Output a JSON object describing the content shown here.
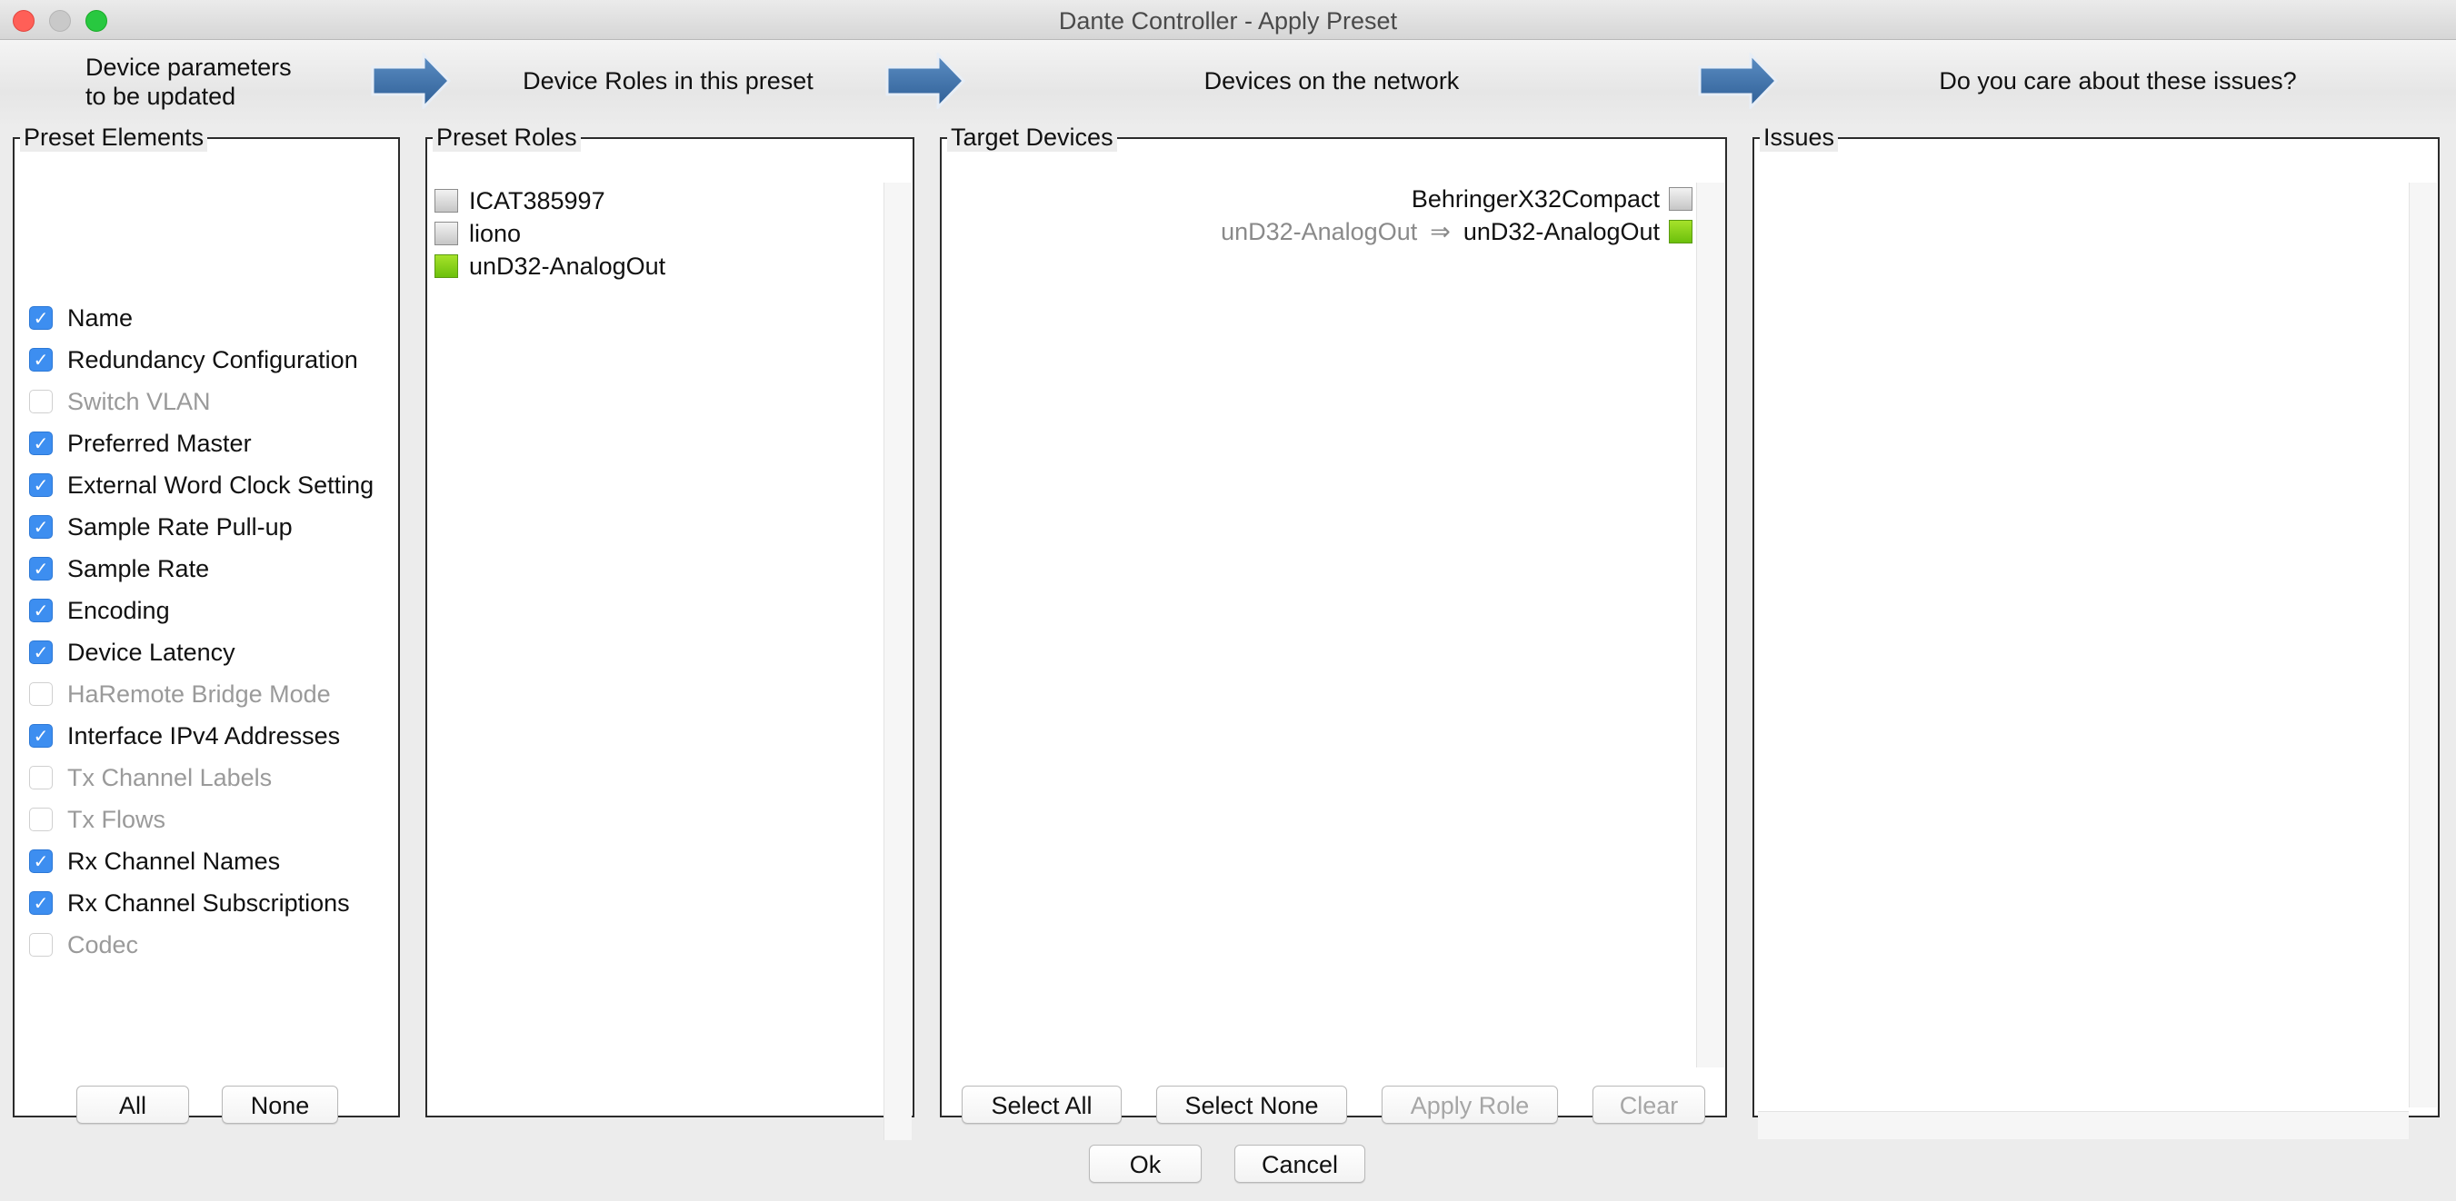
{
  "window": {
    "title": "Dante Controller - Apply Preset"
  },
  "steps": [
    {
      "line1": "Device parameters",
      "line2": "to be updated"
    },
    {
      "label": "Device Roles in this preset"
    },
    {
      "label": "Devices on the network"
    },
    {
      "label": "Do you care about these issues?"
    }
  ],
  "icons": {
    "step_arrow": "right-arrow-icon"
  },
  "colors": {
    "checkbox_on": "#3d8ef0",
    "role_assigned": "#8bd31a",
    "role_unassigned": "#d6d6d6"
  },
  "preset_elements": {
    "legend": "Preset Elements",
    "items": [
      {
        "label": "Name",
        "checked": true,
        "enabled": true
      },
      {
        "label": "Redundancy Configuration",
        "checked": true,
        "enabled": true
      },
      {
        "label": "Switch VLAN",
        "checked": false,
        "enabled": false
      },
      {
        "label": "Preferred Master",
        "checked": true,
        "enabled": true
      },
      {
        "label": "External Word Clock Setting",
        "checked": true,
        "enabled": true
      },
      {
        "label": "Sample Rate Pull-up",
        "checked": true,
        "enabled": true
      },
      {
        "label": "Sample Rate",
        "checked": true,
        "enabled": true
      },
      {
        "label": "Encoding",
        "checked": true,
        "enabled": true
      },
      {
        "label": "Device Latency",
        "checked": true,
        "enabled": true
      },
      {
        "label": "HaRemote Bridge Mode",
        "checked": false,
        "enabled": false
      },
      {
        "label": "Interface IPv4 Addresses",
        "checked": true,
        "enabled": true
      },
      {
        "label": "Tx Channel Labels",
        "checked": false,
        "enabled": false
      },
      {
        "label": "Tx Flows",
        "checked": false,
        "enabled": false
      },
      {
        "label": "Rx Channel Names",
        "checked": true,
        "enabled": true
      },
      {
        "label": "Rx Channel Subscriptions",
        "checked": true,
        "enabled": true
      },
      {
        "label": "Codec",
        "checked": false,
        "enabled": false
      }
    ],
    "all_label": "All",
    "none_label": "None"
  },
  "preset_roles": {
    "legend": "Preset Roles",
    "items": [
      {
        "label": "ICAT385997",
        "status": "gray"
      },
      {
        "label": "liono",
        "status": "gray"
      },
      {
        "label": "unD32-AnalogOut",
        "status": "green"
      }
    ]
  },
  "target_devices": {
    "legend": "Target Devices",
    "rows": [
      {
        "source": "",
        "arrow": "",
        "device": "BehringerX32Compact",
        "status": "gray"
      },
      {
        "source": "unD32-AnalogOut",
        "arrow": "⇒",
        "device": "unD32-AnalogOut",
        "status": "green"
      }
    ],
    "select_all_label": "Select All",
    "select_none_label": "Select None",
    "apply_role_label": "Apply Role",
    "clear_label": "Clear"
  },
  "issues": {
    "legend": "Issues"
  },
  "footer": {
    "ok_label": "Ok",
    "cancel_label": "Cancel"
  }
}
